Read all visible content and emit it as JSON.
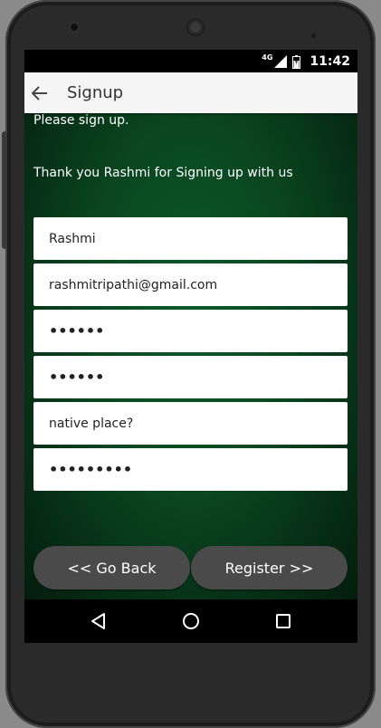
{
  "status_bar": {
    "network": "4G",
    "time": "11:42"
  },
  "app_bar": {
    "title": "Signup"
  },
  "content": {
    "intro": "Please sign up.",
    "thanks": "Thank you Rashmi for Signing up with us"
  },
  "form": {
    "name": "Rashmi",
    "email": "rashmitripathi@gmail.com",
    "password": "••••••",
    "confirm_password": "••••••",
    "security_question": "native place?",
    "security_answer": "•••••••••"
  },
  "buttons": {
    "go_back": "<< Go Back",
    "register": "Register >>"
  },
  "colors": {
    "background_green": "#0a4620",
    "button_gray": "#4a4a4a",
    "app_bar": "#f5f5f5"
  }
}
